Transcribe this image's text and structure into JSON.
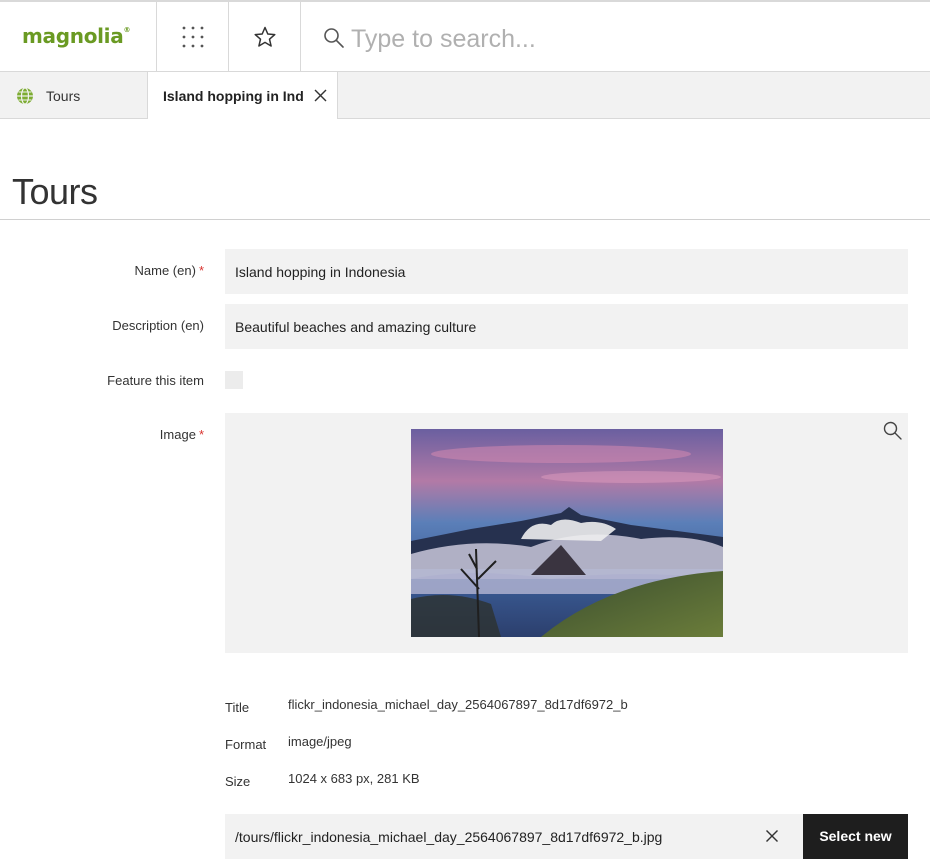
{
  "app": {
    "logo_text": "magnolia",
    "logo_mark": "®",
    "brand_color": "#6a9a23",
    "search_placeholder": "Type to search..."
  },
  "tabs": [
    {
      "label": "Tours",
      "icon": "globe-icon",
      "active": false
    },
    {
      "label": "Island hopping in Ind...",
      "icon": "close-icon",
      "active": true
    }
  ],
  "page": {
    "title": "Tours"
  },
  "form": {
    "name": {
      "label": "Name (en)",
      "required_mark": "*",
      "value": "Island hopping in Indonesia"
    },
    "description": {
      "label": "Description (en)",
      "value": "Beautiful beaches and amazing culture"
    },
    "feature": {
      "label": "Feature this item",
      "checked": false
    },
    "image": {
      "label": "Image",
      "required_mark": "*",
      "meta": {
        "title_label": "Title",
        "title_value": "flickr_indonesia_michael_day_2564067897_8d17df6972_b",
        "format_label": "Format",
        "format_value": "image/jpeg",
        "size_label": "Size",
        "size_value": "1024 x 683 px, 281 KB"
      },
      "path": "/tours/flickr_indonesia_michael_day_2564067897_8d17df6972_b.jpg",
      "select_button": "Select new"
    }
  }
}
